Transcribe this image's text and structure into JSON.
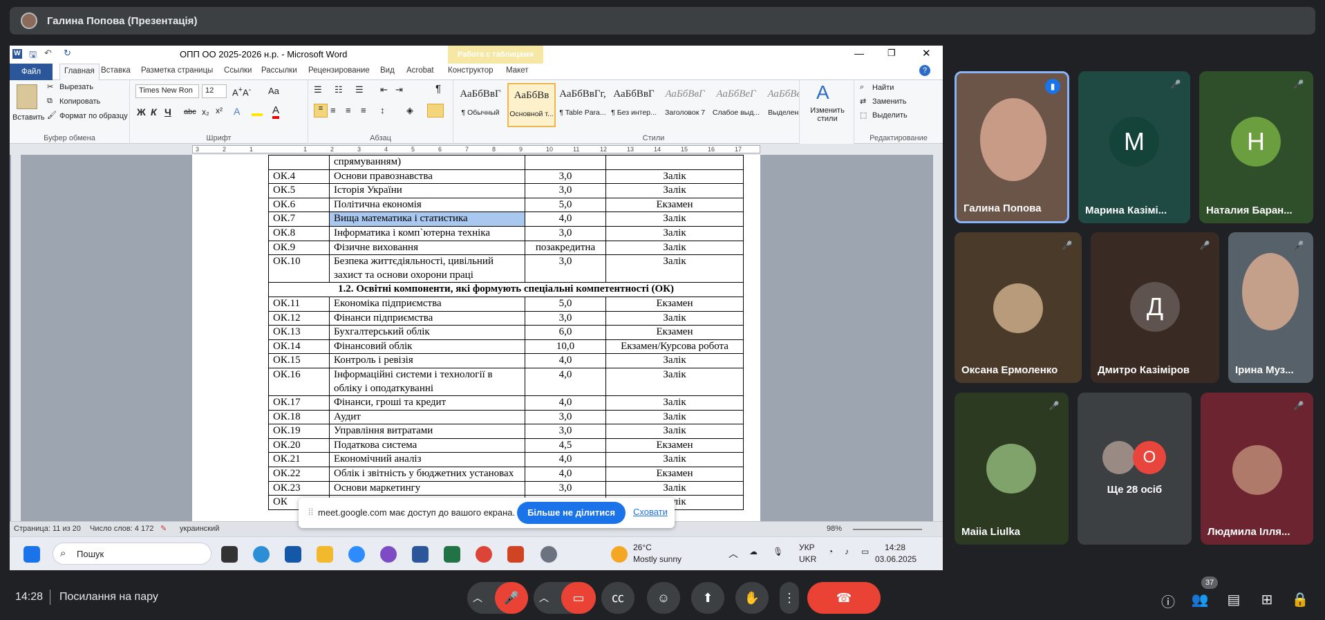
{
  "presenter": {
    "name": "Галина Попова (Презентація)"
  },
  "word": {
    "title": "ОПП ОО 2025-2026 н.р. - Microsoft Word",
    "context_tab": "Работа с таблицами",
    "tabs": [
      "Файл",
      "Главная",
      "Вставка",
      "Разметка страницы",
      "Ссылки",
      "Рассылки",
      "Рецензирование",
      "Вид",
      "Acrobat",
      "Конструктор",
      "Макет"
    ],
    "clipboard": {
      "paste": "Вставить",
      "cut": "Вырезать",
      "copy": "Копировать",
      "format": "Формат по образцу",
      "label": "Буфер обмена"
    },
    "font": {
      "name": "Times New Ron",
      "size": "12",
      "label": "Шрифт"
    },
    "paragraph_label": "Абзац",
    "styles": [
      {
        "preview": "АаБбВвГ",
        "name": "¶ Обычный"
      },
      {
        "preview": "АаБбВв",
        "name": "Основной т..."
      },
      {
        "preview": "АаБбВвГг,",
        "name": "¶ Table Para..."
      },
      {
        "preview": "АаБбВвГ",
        "name": "¶ Без интер..."
      },
      {
        "preview": "АаБбВвГ",
        "name": "Заголовок 7"
      },
      {
        "preview": "АаБбВеГ",
        "name": "Слабое выд..."
      },
      {
        "preview": "АаБбВвГ",
        "name": "Выделение"
      }
    ],
    "styles_label": "Стили",
    "change_styles": "Изменить стили",
    "editing": {
      "find": "Найти",
      "replace": "Заменить",
      "select": "Выделить",
      "label": "Редактирование"
    },
    "table_rows": [
      {
        "code": "",
        "name": "спрямуванням)",
        "credits": "",
        "form": ""
      },
      {
        "code": "ОК.4",
        "name": "Основи правознавства",
        "credits": "3,0",
        "form": "Залік"
      },
      {
        "code": "ОК.5",
        "name": "Історія України",
        "credits": "3,0",
        "form": "Залік"
      },
      {
        "code": "ОК.6",
        "name": "Політична економія",
        "credits": "5,0",
        "form": "Екзамен"
      },
      {
        "code": "ОК.7",
        "name": "Вища математика і статистика",
        "credits": "4,0",
        "form": "Залік"
      },
      {
        "code": "ОК.8",
        "name": "Інформатика і комп`ютерна техніка",
        "credits": "3,0",
        "form": "Залік"
      },
      {
        "code": "ОК.9",
        "name": "Фізичне виховання",
        "credits": "позакредитна",
        "form": "Залік"
      },
      {
        "code": "ОК.10",
        "name": "Безпека життєдіяльності, цивільний захист та основи охорони праці",
        "credits": "3,0",
        "form": "Залік"
      },
      {
        "section": "1.2. Освітні компоненти, які формують спеціальні компетентності (ОК)"
      },
      {
        "code": "ОК.11",
        "name": "Економіка підприємства",
        "credits": "5,0",
        "form": "Екзамен"
      },
      {
        "code": "ОК.12",
        "name": "Фінанси підприємства",
        "credits": "3,0",
        "form": "Залік"
      },
      {
        "code": "ОК.13",
        "name": "Бухгалтерський облік",
        "credits": "6,0",
        "form": "Екзамен"
      },
      {
        "code": "ОК.14",
        "name": "Фінансовий облік",
        "credits": "10,0",
        "form": "Екзамен/Курсова робота"
      },
      {
        "code": "ОК.15",
        "name": "Контроль і ревізія",
        "credits": "4,0",
        "form": "Залік"
      },
      {
        "code": "ОК.16",
        "name": "Інформаційні системи і технології в обліку і оподаткуванні",
        "credits": "4,0",
        "form": "Залік"
      },
      {
        "code": "ОК.17",
        "name": "Фінанси, гроші та кредит",
        "credits": "4,0",
        "form": "Залік"
      },
      {
        "code": "ОК.18",
        "name": "Аудит",
        "credits": "3,0",
        "form": "Залік"
      },
      {
        "code": "ОК.19",
        "name": "Управління витратами",
        "credits": "3,0",
        "form": "Залік"
      },
      {
        "code": "ОК.20",
        "name": "Податкова система",
        "credits": "4,5",
        "form": "Екзамен"
      },
      {
        "code": "ОК.21",
        "name": "Економічний аналіз",
        "credits": "4,0",
        "form": "Залік"
      },
      {
        "code": "ОК.22",
        "name": "Облік і звітність у бюджетних установах",
        "credits": "4,0",
        "form": "Екзамен"
      },
      {
        "code": "ОК.23",
        "name": "Основи маркетингу",
        "credits": "3,0",
        "form": "Залік"
      },
      {
        "code": "ОК",
        "name": "",
        "credits": "",
        "form": "Залік"
      }
    ],
    "status": {
      "page": "Страница: 11 из 20",
      "words": "Число слов: 4 172",
      "lang": "украинский",
      "zoom": "98%"
    },
    "share_banner": {
      "text": "meet.google.com має доступ до вашого екрана.",
      "stop": "Більше не ділитися",
      "hide": "Сховати"
    },
    "taskbar": {
      "search": "Пошук",
      "weather_temp": "26°C",
      "weather_desc": "Mostly sunny",
      "lang1": "УКР",
      "lang2": "UKR",
      "time": "14:28",
      "date": "03.06.2025"
    }
  },
  "participants": [
    {
      "name": "Галина Попова"
    },
    {
      "name": "Марина Казімі...",
      "letter": "М",
      "color": "#1e5a4e"
    },
    {
      "name": "Наталия Баран...",
      "letter": "Н",
      "color": "#6b9e3f"
    },
    {
      "name": "Оксана Ермоленко"
    },
    {
      "name": "Дмитро Казіміров",
      "letter": "Д",
      "color": "#5f5350"
    },
    {
      "name": "Ірина Муз..."
    },
    {
      "name": "Maiia Liulka"
    },
    {
      "name": "Ще 28 осіб",
      "letter": "О"
    },
    {
      "name": "Людмила Ілля..."
    }
  ],
  "participant_count": "37",
  "meeting": {
    "time": "14:28",
    "title": "Посилання на пару"
  }
}
